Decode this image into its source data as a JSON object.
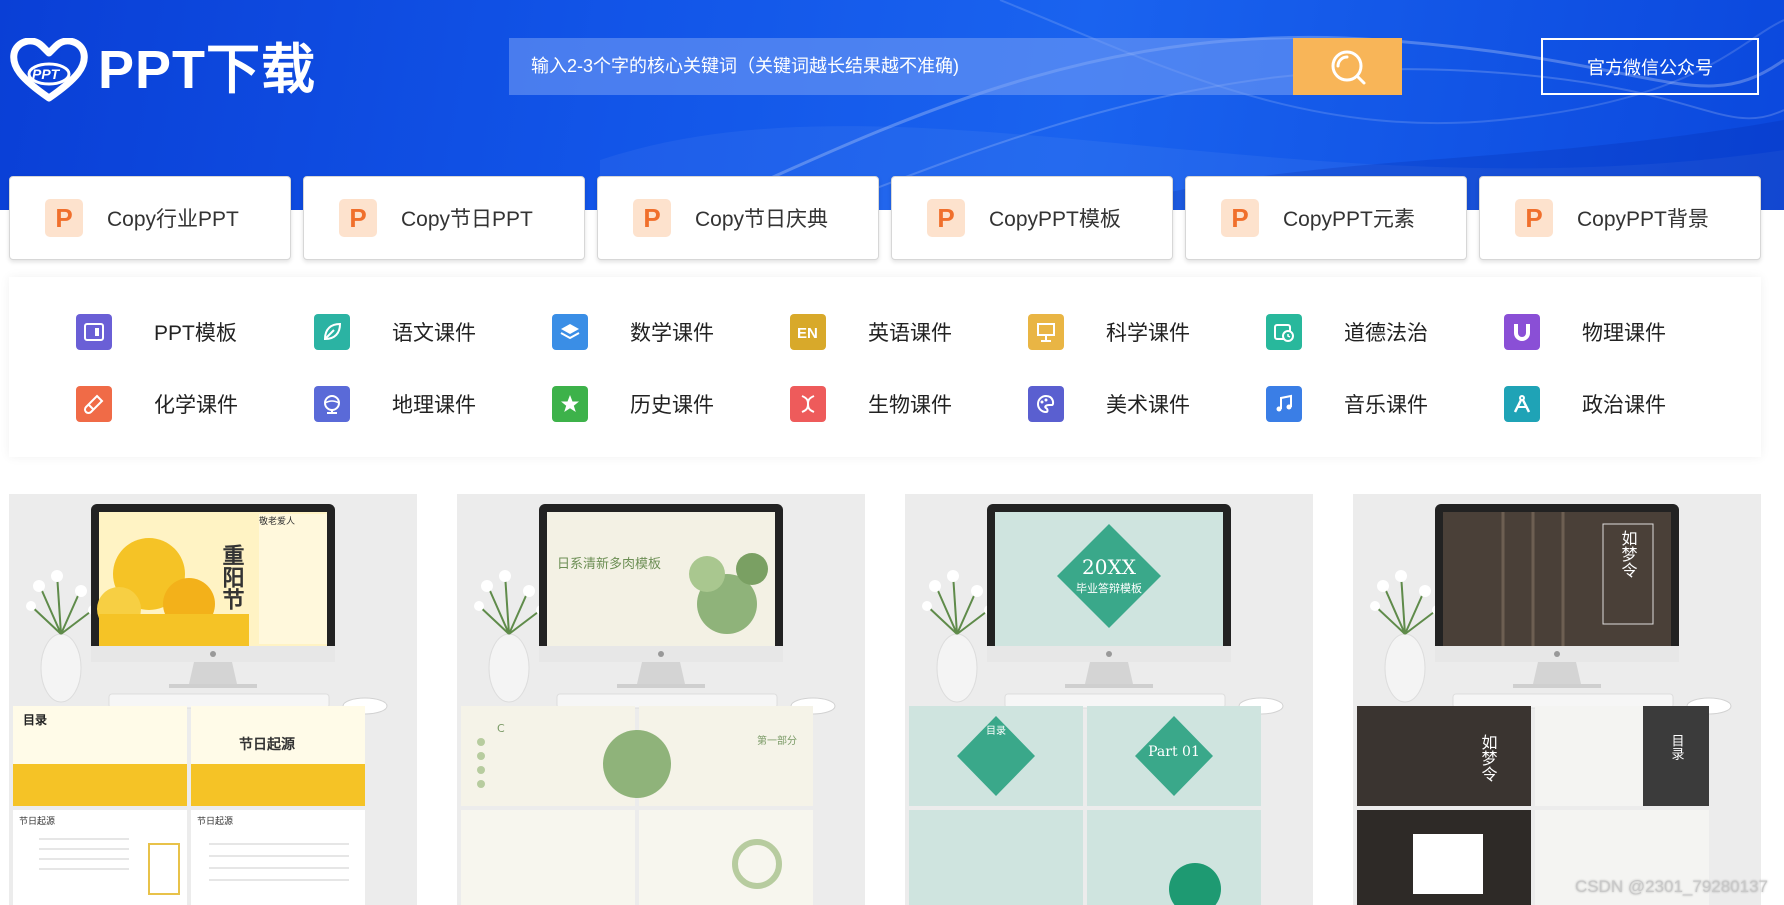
{
  "brand": {
    "logo_text": "PPT下载",
    "logo_mark_text": "PPT"
  },
  "search": {
    "placeholder": "输入2-3个字的核心关键词（关键词越长结果越不准确)",
    "icon": "search-icon"
  },
  "header": {
    "wechat_label": "官方微信公众号"
  },
  "tabs": [
    {
      "icon_letter": "P",
      "label": "Copy行业PPT"
    },
    {
      "icon_letter": "P",
      "label": "Copy节日PPT"
    },
    {
      "icon_letter": "P",
      "label": "Copy节日庆典"
    },
    {
      "icon_letter": "P",
      "label": "CopyPPT模板"
    },
    {
      "icon_letter": "P",
      "label": "CopyPPT元素"
    },
    {
      "icon_letter": "P",
      "label": "CopyPPT背景"
    }
  ],
  "subjects": [
    {
      "label": "PPT模板",
      "icon": "ppt-template-icon",
      "color": "#6a5fd6"
    },
    {
      "label": "语文课件",
      "icon": "leaf-icon",
      "color": "#2bb3a3"
    },
    {
      "label": "数学课件",
      "icon": "layers-icon",
      "color": "#3a8ee6"
    },
    {
      "label": "英语课件",
      "icon": "en-icon",
      "color": "#d8a92a"
    },
    {
      "label": "科学课件",
      "icon": "easel-icon",
      "color": "#e9b544"
    },
    {
      "label": "道德法治",
      "icon": "calendar-clock-icon",
      "color": "#28b89c"
    },
    {
      "label": "物理课件",
      "icon": "magnet-icon",
      "color": "#8a4fd6"
    },
    {
      "label": "化学课件",
      "icon": "test-tube-icon",
      "color": "#f06b47"
    },
    {
      "label": "地理课件",
      "icon": "globe-icon",
      "color": "#5a6ad8"
    },
    {
      "label": "历史课件",
      "icon": "star-icon",
      "color": "#3db24a"
    },
    {
      "label": "生物课件",
      "icon": "dna-icon",
      "color": "#ee5b5b"
    },
    {
      "label": "美术课件",
      "icon": "palette-icon",
      "color": "#5a5fd0"
    },
    {
      "label": "音乐课件",
      "icon": "music-note-icon",
      "color": "#3a7ee6"
    },
    {
      "label": "政治课件",
      "icon": "compass-icon",
      "color": "#1fa3b6"
    }
  ],
  "cards": [
    {
      "title": "重阳节",
      "subtitle": "敬老爱人",
      "slide1": "目录",
      "slide2": "节日起源",
      "slide3": "节日起源",
      "slide4": "节日起源",
      "theme": "#f5c326"
    },
    {
      "title": "日系清新多肉模板",
      "slide1": "C",
      "slide2": "第一部分",
      "theme": "#9fbf86"
    },
    {
      "title": "20XX",
      "subtitle": "毕业答辩模板",
      "slide1": "目录",
      "slide2": "Part 01",
      "theme": "#3aa88a"
    },
    {
      "title": "如梦令",
      "slide1": "如梦令",
      "slide2": "目录",
      "theme": "#3b3b3b"
    }
  ],
  "watermark": "CSDN @2301_79280137"
}
